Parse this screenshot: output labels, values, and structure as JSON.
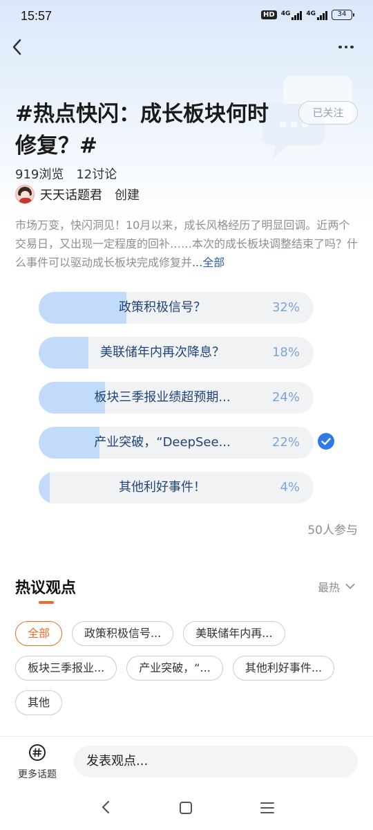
{
  "status_bar": {
    "time": "15:57",
    "hd_label": "HD",
    "network_1": "4G",
    "network_2": "4G",
    "battery": "34"
  },
  "topic": {
    "title": "#热点快闪：成长板块何时修复？#",
    "follow_label": "已关注",
    "views": "919浏览",
    "discussions": "12讨论",
    "creator_name": "天天话题君",
    "created_label": "创建",
    "description": "市场万变，快闪洞见！10月以来，成长风格经历了明显回调。近两个交易日，又出现一定程度的回补……本次的成长板块调整结束了吗？什么事件可以驱动成长板块完成修复并",
    "more_label": "...全部"
  },
  "poll": {
    "options": [
      {
        "label": "政策积极信号？",
        "percent": "32%",
        "fill": 0.32,
        "selected": false
      },
      {
        "label": "美联储年内再次降息？",
        "percent": "18%",
        "fill": 0.18,
        "selected": false
      },
      {
        "label": "板块三季报业绩超预期...",
        "percent": "24%",
        "fill": 0.24,
        "selected": false
      },
      {
        "label": "产业突破，“DeepSee...",
        "percent": "22%",
        "fill": 0.22,
        "selected": true
      },
      {
        "label": "其他利好事件！",
        "percent": "4%",
        "fill": 0.04,
        "selected": false
      }
    ],
    "participants": "50人参与"
  },
  "hot_views": {
    "title": "热议观点",
    "sort_label": "最热",
    "chips_row1": [
      "全部",
      "政策积极信号...",
      "美联储年内再..."
    ],
    "chips_row2": [
      "板块三季报业...",
      "产业突破，“...",
      "其他利好事件..."
    ],
    "chips_row3": [
      "其他"
    ]
  },
  "bottom_bar": {
    "more_topics_label": "更多话题",
    "comment_placeholder": "发表观点..."
  },
  "colors": {
    "accent_orange": "#ee6a2a",
    "poll_fill": "#c3dbfa",
    "poll_text": "#1e4478",
    "check_blue": "#2f7ae5"
  }
}
